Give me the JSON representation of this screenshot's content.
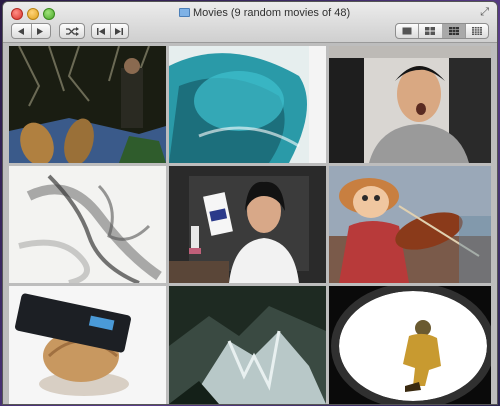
{
  "window": {
    "title": "Movies (9 random movies of 48)"
  },
  "toolbar": {
    "back_icon": "triangle-left-icon",
    "forward_icon": "triangle-right-icon",
    "shuffle_icon": "shuffle-icon",
    "previous_icon": "skip-back-icon",
    "next_icon": "skip-forward-icon",
    "view_options": [
      "1-up",
      "4-up",
      "9-up",
      "16-up"
    ],
    "selected_view": "9-up"
  },
  "colors": {
    "titlebar": "#dcdcdc",
    "grid_background": "#bdbdbd",
    "selected_segment": "#a9a9a9"
  },
  "movies": [
    {
      "scene": "man-in-forest-boots"
    },
    {
      "scene": "blue-imac-closeup"
    },
    {
      "scene": "man-shouting"
    },
    {
      "scene": "grey-brush-smoke"
    },
    {
      "scene": "teen-holding-milk-carton"
    },
    {
      "scene": "puppet-playing-violin"
    },
    {
      "scene": "pentium-chip-on-snail"
    },
    {
      "scene": "snowy-mountain-cliff"
    },
    {
      "scene": "astronaut-in-tunnel"
    }
  ]
}
